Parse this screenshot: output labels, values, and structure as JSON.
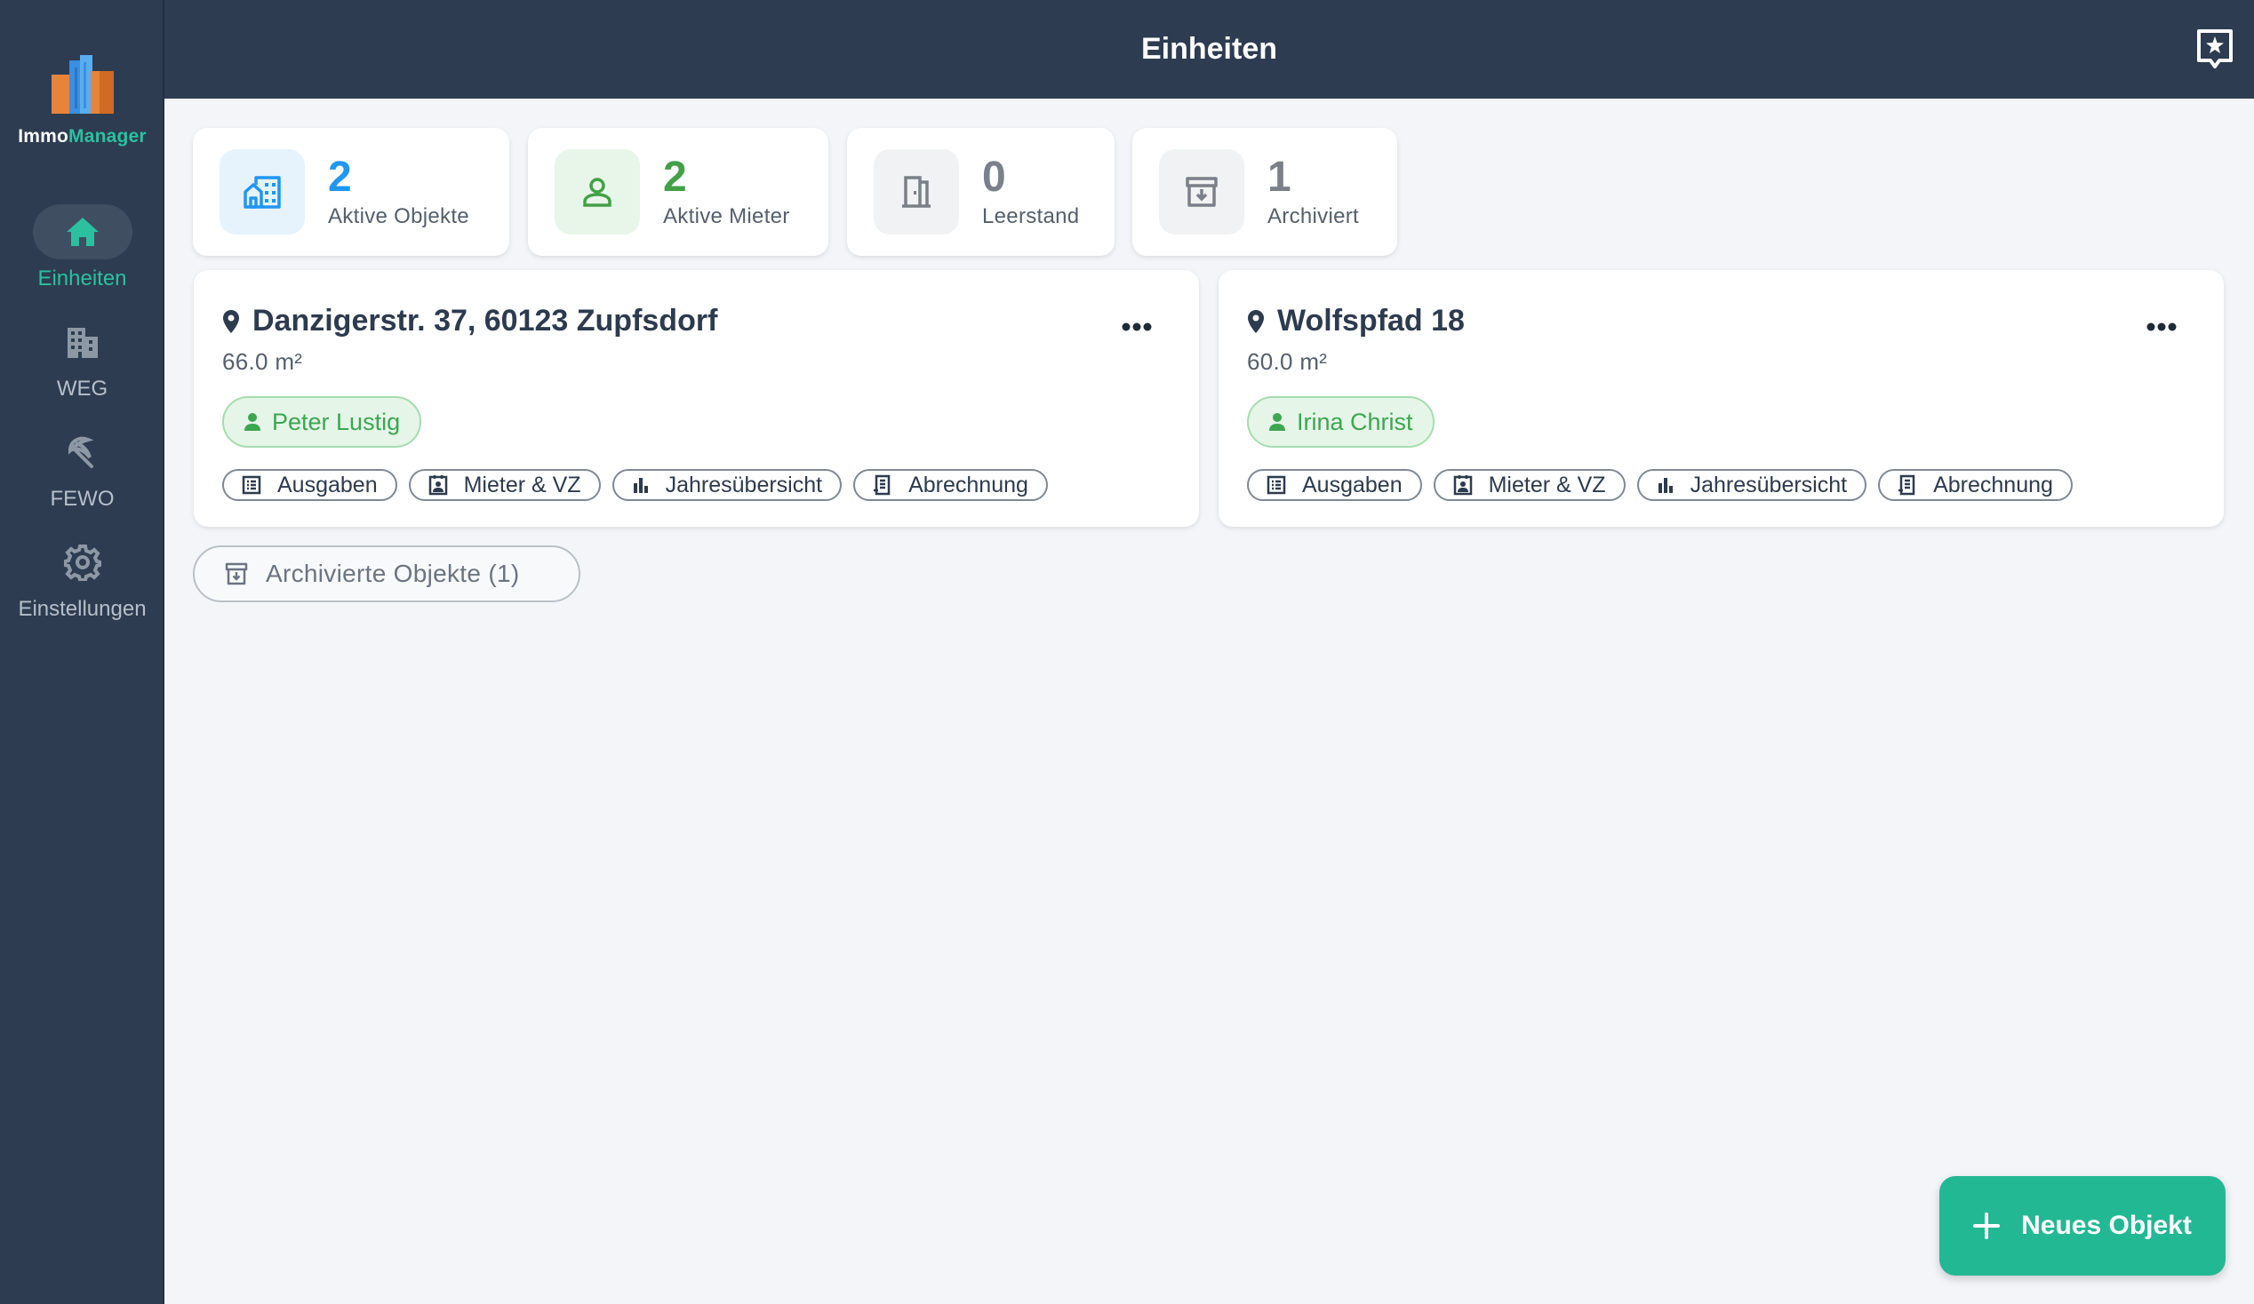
{
  "app": {
    "logo_part1": "Immo",
    "logo_part2": "Manager"
  },
  "sidebar": {
    "items": [
      {
        "label": "Einheiten",
        "icon": "home-icon",
        "active": true
      },
      {
        "label": "WEG",
        "icon": "building-icon",
        "active": false
      },
      {
        "label": "FEWO",
        "icon": "beach-umbrella-icon",
        "active": false
      },
      {
        "label": "Einstellungen",
        "icon": "gear-icon",
        "active": false
      }
    ]
  },
  "header": {
    "title": "Einheiten",
    "action_icon": "bookmark-add-icon"
  },
  "stats": [
    {
      "value": "2",
      "label": "Aktive Objekte",
      "color": "#2196f3",
      "bg": "#e6f3fd",
      "icon": "buildings-icon"
    },
    {
      "value": "2",
      "label": "Aktive Mieter",
      "color": "#43a047",
      "bg": "#e8f5e9",
      "icon": "person-icon"
    },
    {
      "value": "0",
      "label": "Leerstand",
      "color": "#7b8088",
      "bg": "#f1f2f3",
      "icon": "door-icon"
    },
    {
      "value": "1",
      "label": "Archiviert",
      "color": "#7b8088",
      "bg": "#f1f2f3",
      "icon": "archive-icon"
    }
  ],
  "properties": [
    {
      "address": "Danzigerstr. 37, 60123 Zupfsdorf",
      "size": "66.0 m²",
      "tenant": "Peter Lustig",
      "actions": [
        "Ausgaben",
        "Mieter & VZ",
        "Jahresübersicht",
        "Abrechnung"
      ]
    },
    {
      "address": "Wolfspfad 18",
      "size": "60.0 m²",
      "tenant": "Irina Christ",
      "actions": [
        "Ausgaben",
        "Mieter & VZ",
        "Jahresübersicht",
        "Abrechnung"
      ]
    }
  ],
  "archived_button": "Archivierte Objekte (1)",
  "fab": {
    "label": "Neues Objekt",
    "icon": "plus-icon"
  },
  "colors": {
    "sidebar_bg": "#2d3c50",
    "accent": "#2bc0a0",
    "fab": "#23b894",
    "tenant_green": "#3da651"
  }
}
